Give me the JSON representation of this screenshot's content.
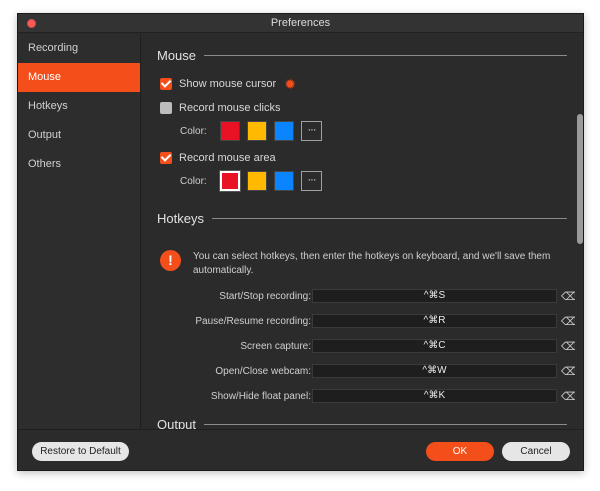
{
  "window": {
    "title": "Preferences"
  },
  "sidebar": {
    "items": [
      {
        "label": "Recording",
        "active": false
      },
      {
        "label": "Mouse",
        "active": true
      },
      {
        "label": "Hotkeys",
        "active": false
      },
      {
        "label": "Output",
        "active": false
      },
      {
        "label": "Others",
        "active": false
      }
    ]
  },
  "mouse": {
    "heading": "Mouse",
    "show_cursor": {
      "label": "Show mouse cursor",
      "checked": true
    },
    "record_clicks": {
      "label": "Record mouse clicks",
      "checked": false,
      "color_label": "Color:",
      "more": "···"
    },
    "record_area": {
      "label": "Record mouse area",
      "checked": true,
      "color_label": "Color:",
      "more": "···"
    },
    "swatch_colors": [
      "#e81224",
      "#ffb900",
      "#0a84ff"
    ]
  },
  "hotkeys": {
    "heading": "Hotkeys",
    "info": "You can select hotkeys, then enter the hotkeys on keyboard, and we'll save them automatically.",
    "rows": [
      {
        "label": "Start/Stop recording:",
        "keys": "^⌘S"
      },
      {
        "label": "Pause/Resume recording:",
        "keys": "^⌘R"
      },
      {
        "label": "Screen capture:",
        "keys": "^⌘C"
      },
      {
        "label": "Open/Close webcam:",
        "keys": "^⌘W"
      },
      {
        "label": "Show/Hide float panel:",
        "keys": "^⌘K"
      }
    ],
    "clear_glyph": "⌫"
  },
  "output": {
    "heading": "Output"
  },
  "footer": {
    "restore_label": "Restore to Default",
    "ok_label": "OK",
    "cancel_label": "Cancel"
  },
  "theme": {
    "accent": "#f44e1b",
    "background": "#2b2b2b"
  }
}
